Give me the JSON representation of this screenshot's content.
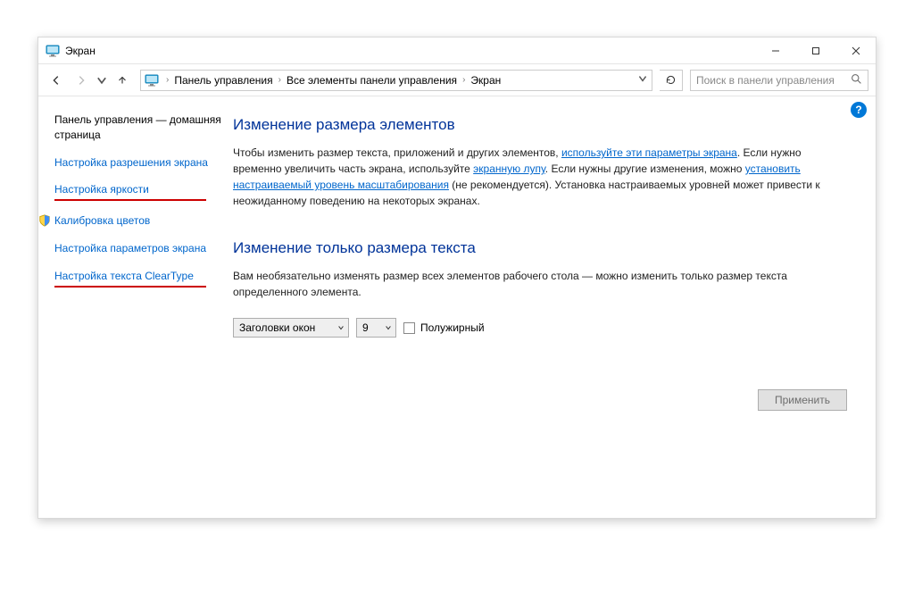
{
  "window": {
    "title": "Экран"
  },
  "breadcrumbs": {
    "b1": "Панель управления",
    "b2": "Все элементы панели управления",
    "b3": "Экран"
  },
  "search": {
    "placeholder": "Поиск в панели управления"
  },
  "sidebar": {
    "home": "Панель управления — домашняя страница",
    "items": [
      "Настройка разрешения экрана",
      "Настройка яркости",
      "Калибровка цветов",
      "Настройка параметров экрана",
      "Настройка текста ClearType"
    ]
  },
  "main": {
    "h1": "Изменение размера элементов",
    "p1a": "Чтобы изменить размер текста, приложений и других элементов, ",
    "p1link1": "используйте эти параметры экрана",
    "p1b": ". Если нужно временно увеличить часть экрана, используйте ",
    "p1link2": "экранную лупу",
    "p1c": ". Если нужны другие изменения, можно ",
    "p1link3": "установить настраиваемый уровень масштабирования",
    "p1d": " (не рекомендуется). Установка настраиваемых уровней может привести к неожиданному поведению на некоторых экранах.",
    "h2": "Изменение только размера текста",
    "p2": "Вам необязательно изменять размер всех элементов рабочего стола — можно изменить только размер текста определенного элемента.",
    "combo1": "Заголовки окон",
    "combo2": "9",
    "bold_label": "Полужирный",
    "apply": "Применить"
  },
  "help": "?"
}
